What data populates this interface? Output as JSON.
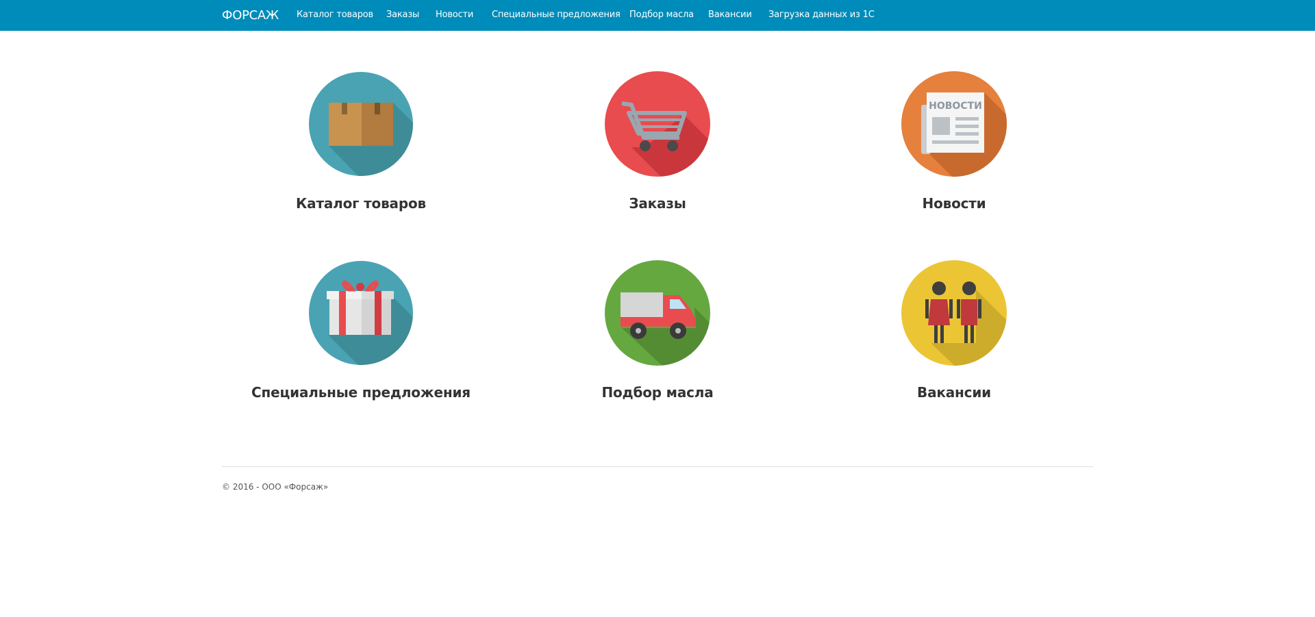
{
  "navbar": {
    "brand": "ФОРСАЖ",
    "items": [
      {
        "label": "Каталог товаров"
      },
      {
        "label": "Заказы"
      },
      {
        "label": "Новости"
      },
      {
        "label": "Специальные предложения"
      },
      {
        "label": "Подбор масла"
      },
      {
        "label": "Вакансии"
      },
      {
        "label": "Загрузка данных из 1С"
      }
    ]
  },
  "tiles": [
    {
      "label": "Каталог товаров",
      "icon": "box-icon",
      "color": "#4aa3b3"
    },
    {
      "label": "Заказы",
      "icon": "shopping-cart-icon",
      "color": "#e84c4f"
    },
    {
      "label": "Новости",
      "icon": "newspaper-icon",
      "color": "#e5803d",
      "icon_text": "НОВОСТИ"
    },
    {
      "label": "Специальные предложения",
      "icon": "gift-icon",
      "color": "#4aa3b3"
    },
    {
      "label": "Подбор масла",
      "icon": "truck-icon",
      "color": "#66a840"
    },
    {
      "label": "Вакансии",
      "icon": "people-icon",
      "color": "#ebc534"
    }
  ],
  "footer": {
    "text": "© 2016 - ООО «Форсаж»"
  },
  "colors": {
    "navbar": "#008cba",
    "text": "#333333"
  }
}
